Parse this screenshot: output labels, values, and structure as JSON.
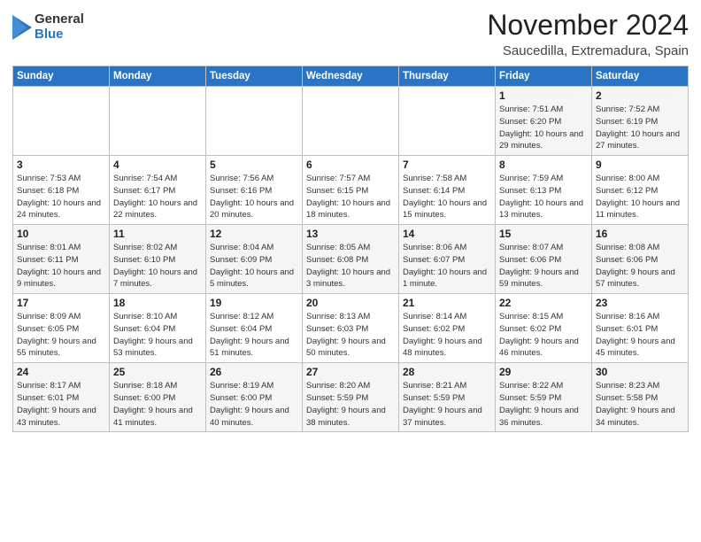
{
  "logo": {
    "general": "General",
    "blue": "Blue"
  },
  "header": {
    "month": "November 2024",
    "location": "Saucedilla, Extremadura, Spain"
  },
  "days_of_week": [
    "Sunday",
    "Monday",
    "Tuesday",
    "Wednesday",
    "Thursday",
    "Friday",
    "Saturday"
  ],
  "weeks": [
    [
      {
        "day": "",
        "info": ""
      },
      {
        "day": "",
        "info": ""
      },
      {
        "day": "",
        "info": ""
      },
      {
        "day": "",
        "info": ""
      },
      {
        "day": "",
        "info": ""
      },
      {
        "day": "1",
        "info": "Sunrise: 7:51 AM\nSunset: 6:20 PM\nDaylight: 10 hours and 29 minutes."
      },
      {
        "day": "2",
        "info": "Sunrise: 7:52 AM\nSunset: 6:19 PM\nDaylight: 10 hours and 27 minutes."
      }
    ],
    [
      {
        "day": "3",
        "info": "Sunrise: 7:53 AM\nSunset: 6:18 PM\nDaylight: 10 hours and 24 minutes."
      },
      {
        "day": "4",
        "info": "Sunrise: 7:54 AM\nSunset: 6:17 PM\nDaylight: 10 hours and 22 minutes."
      },
      {
        "day": "5",
        "info": "Sunrise: 7:56 AM\nSunset: 6:16 PM\nDaylight: 10 hours and 20 minutes."
      },
      {
        "day": "6",
        "info": "Sunrise: 7:57 AM\nSunset: 6:15 PM\nDaylight: 10 hours and 18 minutes."
      },
      {
        "day": "7",
        "info": "Sunrise: 7:58 AM\nSunset: 6:14 PM\nDaylight: 10 hours and 15 minutes."
      },
      {
        "day": "8",
        "info": "Sunrise: 7:59 AM\nSunset: 6:13 PM\nDaylight: 10 hours and 13 minutes."
      },
      {
        "day": "9",
        "info": "Sunrise: 8:00 AM\nSunset: 6:12 PM\nDaylight: 10 hours and 11 minutes."
      }
    ],
    [
      {
        "day": "10",
        "info": "Sunrise: 8:01 AM\nSunset: 6:11 PM\nDaylight: 10 hours and 9 minutes."
      },
      {
        "day": "11",
        "info": "Sunrise: 8:02 AM\nSunset: 6:10 PM\nDaylight: 10 hours and 7 minutes."
      },
      {
        "day": "12",
        "info": "Sunrise: 8:04 AM\nSunset: 6:09 PM\nDaylight: 10 hours and 5 minutes."
      },
      {
        "day": "13",
        "info": "Sunrise: 8:05 AM\nSunset: 6:08 PM\nDaylight: 10 hours and 3 minutes."
      },
      {
        "day": "14",
        "info": "Sunrise: 8:06 AM\nSunset: 6:07 PM\nDaylight: 10 hours and 1 minute."
      },
      {
        "day": "15",
        "info": "Sunrise: 8:07 AM\nSunset: 6:06 PM\nDaylight: 9 hours and 59 minutes."
      },
      {
        "day": "16",
        "info": "Sunrise: 8:08 AM\nSunset: 6:06 PM\nDaylight: 9 hours and 57 minutes."
      }
    ],
    [
      {
        "day": "17",
        "info": "Sunrise: 8:09 AM\nSunset: 6:05 PM\nDaylight: 9 hours and 55 minutes."
      },
      {
        "day": "18",
        "info": "Sunrise: 8:10 AM\nSunset: 6:04 PM\nDaylight: 9 hours and 53 minutes."
      },
      {
        "day": "19",
        "info": "Sunrise: 8:12 AM\nSunset: 6:04 PM\nDaylight: 9 hours and 51 minutes."
      },
      {
        "day": "20",
        "info": "Sunrise: 8:13 AM\nSunset: 6:03 PM\nDaylight: 9 hours and 50 minutes."
      },
      {
        "day": "21",
        "info": "Sunrise: 8:14 AM\nSunset: 6:02 PM\nDaylight: 9 hours and 48 minutes."
      },
      {
        "day": "22",
        "info": "Sunrise: 8:15 AM\nSunset: 6:02 PM\nDaylight: 9 hours and 46 minutes."
      },
      {
        "day": "23",
        "info": "Sunrise: 8:16 AM\nSunset: 6:01 PM\nDaylight: 9 hours and 45 minutes."
      }
    ],
    [
      {
        "day": "24",
        "info": "Sunrise: 8:17 AM\nSunset: 6:01 PM\nDaylight: 9 hours and 43 minutes."
      },
      {
        "day": "25",
        "info": "Sunrise: 8:18 AM\nSunset: 6:00 PM\nDaylight: 9 hours and 41 minutes."
      },
      {
        "day": "26",
        "info": "Sunrise: 8:19 AM\nSunset: 6:00 PM\nDaylight: 9 hours and 40 minutes."
      },
      {
        "day": "27",
        "info": "Sunrise: 8:20 AM\nSunset: 5:59 PM\nDaylight: 9 hours and 38 minutes."
      },
      {
        "day": "28",
        "info": "Sunrise: 8:21 AM\nSunset: 5:59 PM\nDaylight: 9 hours and 37 minutes."
      },
      {
        "day": "29",
        "info": "Sunrise: 8:22 AM\nSunset: 5:59 PM\nDaylight: 9 hours and 36 minutes."
      },
      {
        "day": "30",
        "info": "Sunrise: 8:23 AM\nSunset: 5:58 PM\nDaylight: 9 hours and 34 minutes."
      }
    ]
  ]
}
